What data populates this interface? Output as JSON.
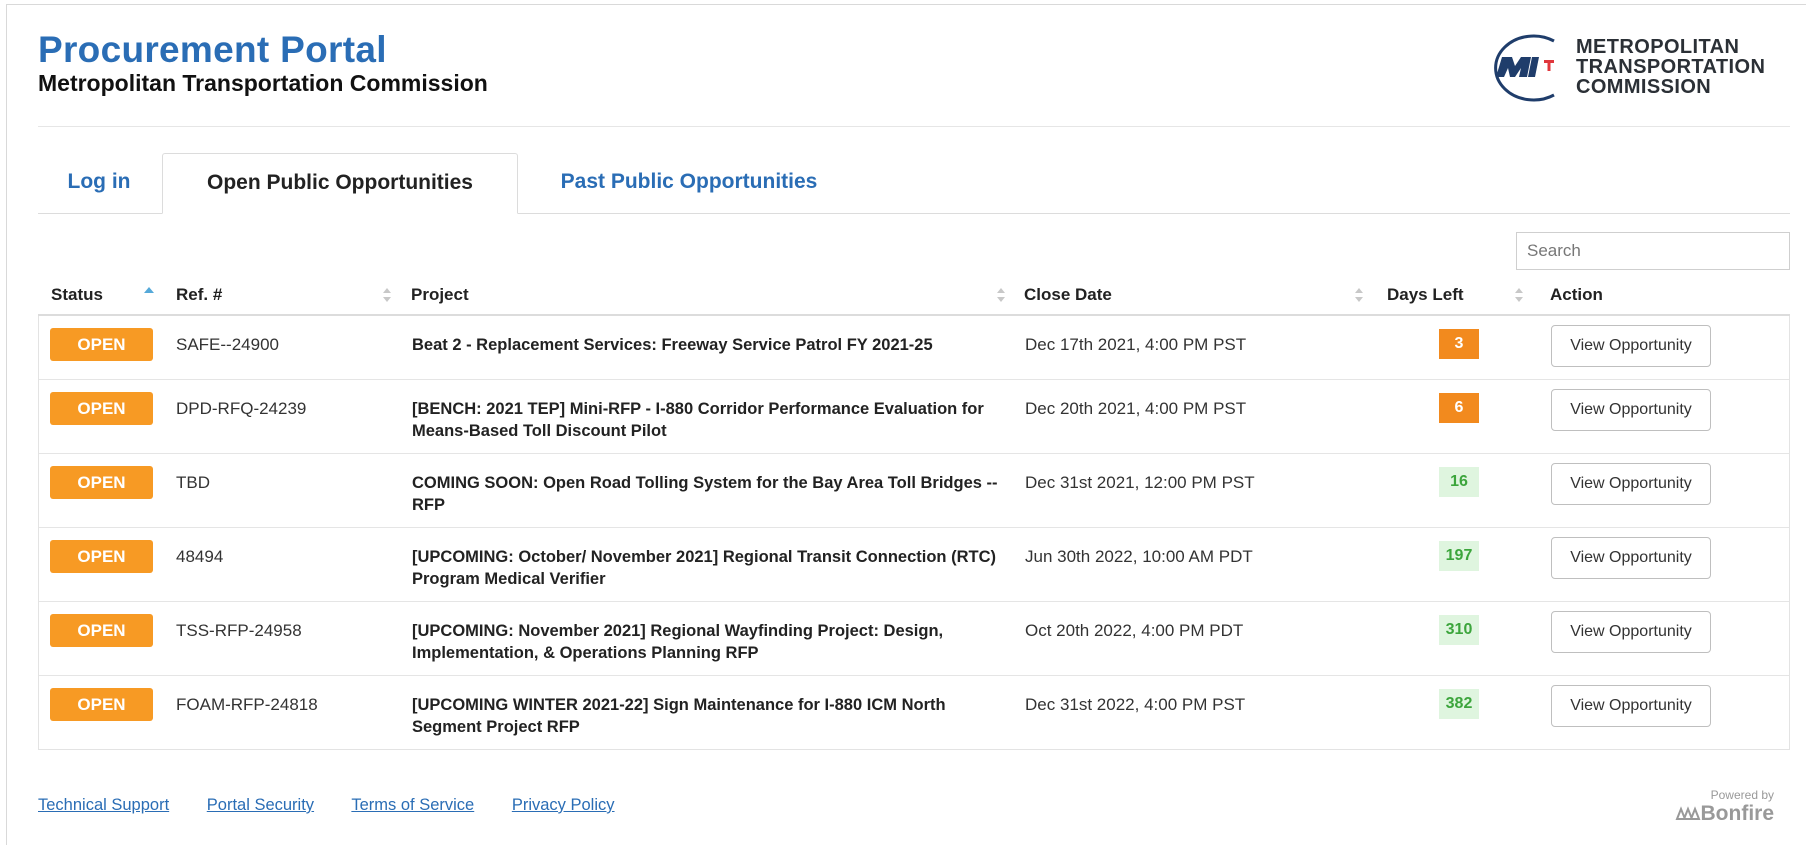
{
  "header": {
    "title": "Procurement Portal",
    "subtitle": "Metropolitan Transportation Commission"
  },
  "logo": {
    "lines": [
      "METROPOLITAN",
      "TRANSPORTATION",
      "COMMISSION"
    ],
    "colors": {
      "mark": "#1f3d6b",
      "accent": "#e0373c"
    }
  },
  "tabs": [
    {
      "label": "Log in",
      "active": false
    },
    {
      "label": "Open Public Opportunities",
      "active": true
    },
    {
      "label": "Past Public Opportunities",
      "active": false
    }
  ],
  "search": {
    "placeholder": "Search"
  },
  "table": {
    "columns": [
      "Status",
      "Ref. #",
      "Project",
      "Close Date",
      "Days Left",
      "Action"
    ],
    "sorted_column": "Status",
    "sort_direction": "ascending",
    "rows": [
      {
        "status": "OPEN",
        "ref": "SAFE--24900",
        "project": "Beat 2 - Replacement Services: Freeway Service Patrol FY 2021-25",
        "close_date": "Dec 17th 2021, 4:00 PM PST",
        "days_left": "3",
        "days_level": "warn",
        "action": "View Opportunity"
      },
      {
        "status": "OPEN",
        "ref": "DPD-RFQ-24239",
        "project": "[BENCH: 2021 TEP] Mini-RFP - I-880 Corridor Performance Evaluation for Means-Based Toll Discount Pilot",
        "close_date": "Dec 20th 2021, 4:00 PM PST",
        "days_left": "6",
        "days_level": "warn",
        "action": "View Opportunity"
      },
      {
        "status": "OPEN",
        "ref": "TBD",
        "project": "COMING SOON: Open Road Tolling System for the Bay Area Toll Bridges -- RFP",
        "close_date": "Dec 31st 2021, 12:00 PM PST",
        "days_left": "16",
        "days_level": "ok",
        "action": "View Opportunity"
      },
      {
        "status": "OPEN",
        "ref": "48494",
        "project": "[UPCOMING: October/ November 2021] Regional Transit Connection (RTC) Program Medical Verifier",
        "close_date": "Jun 30th 2022, 10:00 AM PDT",
        "days_left": "197",
        "days_level": "ok",
        "action": "View Opportunity"
      },
      {
        "status": "OPEN",
        "ref": "TSS-RFP-24958",
        "project": "[UPCOMING: November 2021] Regional Wayfinding Project: Design, Implementation, & Operations Planning RFP",
        "close_date": "Oct 20th 2022, 4:00 PM PDT",
        "days_left": "310",
        "days_level": "ok",
        "action": "View Opportunity"
      },
      {
        "status": "OPEN",
        "ref": "FOAM-RFP-24818",
        "project": "[UPCOMING WINTER 2021-22] Sign Maintenance for I-880 ICM North Segment Project RFP",
        "close_date": "Dec 31st 2022, 4:00 PM PST",
        "days_left": "382",
        "days_level": "ok",
        "action": "View Opportunity"
      }
    ]
  },
  "footer": {
    "links": [
      "Technical Support",
      "Portal Security",
      "Terms of Service",
      "Privacy Policy"
    ],
    "powered_by": "Powered by",
    "brand": "Bonfire"
  },
  "colors": {
    "accent": "#2a6db5",
    "open_badge": "#f79a24",
    "days_warn": "#f28a1e",
    "days_ok_bg": "#dff5df",
    "days_ok_text": "#3ca53c"
  }
}
